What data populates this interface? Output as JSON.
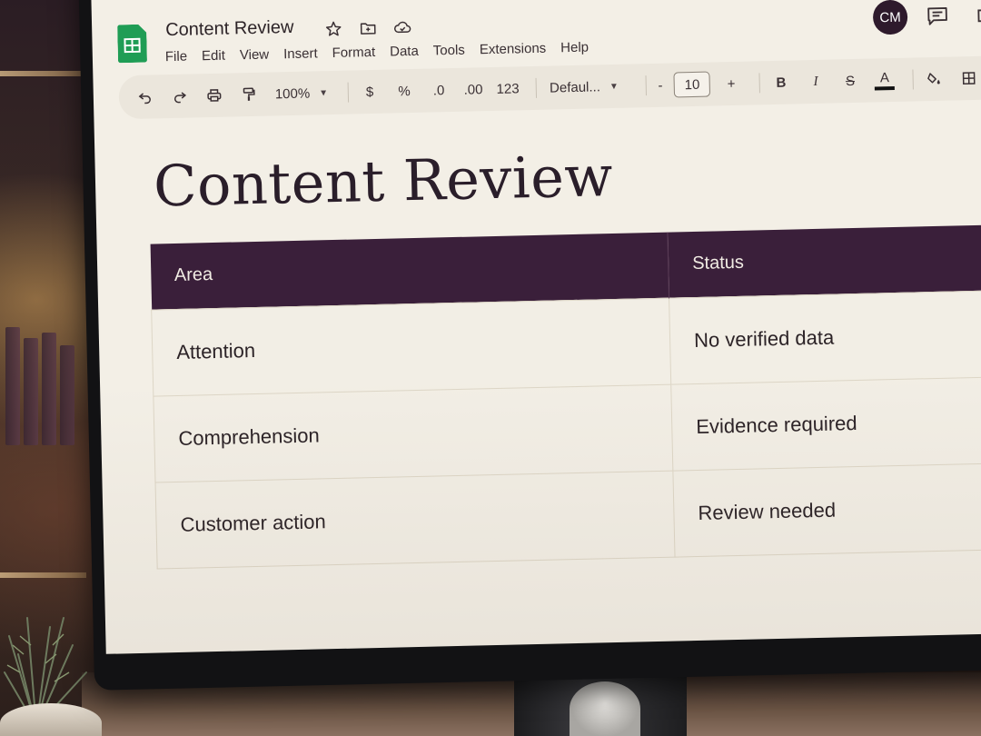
{
  "document": {
    "title": "Content Review",
    "avatar_initials": "CM"
  },
  "menu": [
    {
      "label": "File"
    },
    {
      "label": "Edit"
    },
    {
      "label": "View"
    },
    {
      "label": "Insert"
    },
    {
      "label": "Format"
    },
    {
      "label": "Data"
    },
    {
      "label": "Tools"
    },
    {
      "label": "Extensions"
    },
    {
      "label": "Help"
    }
  ],
  "toolbar": {
    "zoom": "100%",
    "currency": "$",
    "percent": "%",
    "decrease_decimal": ".0",
    "increase_decimal": ".00",
    "number_format": "123",
    "font": "Defaul...",
    "font_size": "10",
    "minus": "-",
    "plus": "+",
    "bold": "B",
    "italic": "I",
    "strike": "S",
    "text_color_label": "A"
  },
  "icons": {
    "star": "star-icon",
    "move": "folder-move-icon",
    "cloud": "cloud-saved-icon",
    "comment": "comment-icon",
    "undo": "undo-icon",
    "redo": "redo-icon",
    "print": "print-icon",
    "paint_format": "paint-format-icon",
    "fill": "fill-color-icon",
    "borders": "borders-icon"
  },
  "sheet": {
    "heading": "Content Review",
    "columns": [
      "Area",
      "Status"
    ],
    "rows": [
      [
        "Attention",
        "No verified data"
      ],
      [
        "Comprehension",
        "Evidence required"
      ],
      [
        "Customer action",
        "Review needed"
      ]
    ]
  },
  "colors": {
    "header_bg": "#3a1f3a",
    "sheet_bg": "#f3efe6",
    "brand_green": "#1f9d55"
  }
}
